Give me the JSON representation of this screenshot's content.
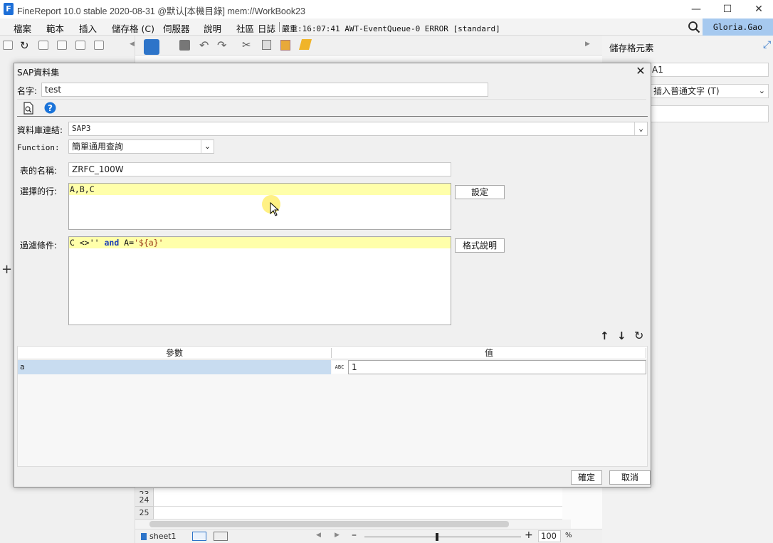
{
  "window": {
    "title": "FineReport 10.0 stable 2020-08-31 @默认[本機目錄]     mem://WorkBook23"
  },
  "menubar": {
    "items": [
      "檔案",
      "範本",
      "插入",
      "儲存格 (C)",
      "伺服器",
      "說明",
      "社區"
    ],
    "log_label": "日誌",
    "log_text": "嚴重:16:07:41 AWT-EventQueue-0 ERROR [standard]",
    "user": "Gloria.Gao"
  },
  "rightpanel": {
    "title": "儲存格元素",
    "cell_ref": "A1",
    "insert_type": "插入普通文字 (T)"
  },
  "sheet": {
    "rows": [
      "23",
      "24",
      "25"
    ],
    "tab": "sheet1",
    "zoom": "100",
    "zoom_unit": "%"
  },
  "dialog": {
    "title": "SAP資料集",
    "name_label": "名字:",
    "name_value": "test",
    "db_label": "資料庫連結:",
    "db_value": "SAP3",
    "function_label": "Function:",
    "function_value": "簡單通用查詢",
    "table_label": "表的名稱:",
    "table_value": "ZRFC_100W",
    "columns_label": "選擇的行:",
    "columns_value": "A,B,C",
    "set_button": "設定",
    "filter_label": "過濾條件:",
    "filter_parts": [
      "C <>'' ",
      "and",
      " A=",
      "'${a}'"
    ],
    "format_button": "格式說明",
    "param_header": "參數",
    "value_header": "值",
    "param_name": "a",
    "param_type": "ABC",
    "param_value": "1",
    "ok_button": "確定",
    "cancel_button": "取消"
  }
}
